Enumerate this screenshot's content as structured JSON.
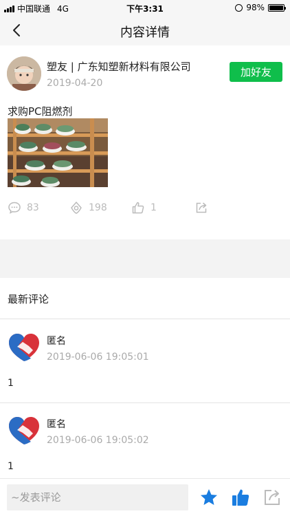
{
  "status_bar": {
    "carrier": "中国联通",
    "network": "4G",
    "time": "下午3:31",
    "battery": "98%",
    "battery_level": 0.98
  },
  "nav": {
    "title": "内容详情",
    "back_icon": "chevron-left-icon"
  },
  "post": {
    "author": "塑友 | 广东知塑新材料有限公司",
    "date": "2019-04-20",
    "add_friend_label": "加好友",
    "text": "求购PC阻燃剂",
    "comments_count": "83",
    "views_count": "198",
    "likes_count": "1",
    "icons": [
      "comment-icon",
      "eye-icon",
      "thumbs-up-icon",
      "share-icon"
    ]
  },
  "comments_section": {
    "title": "最新评论",
    "items": [
      {
        "name": "匿名",
        "date": "2019-06-06 19:05:01",
        "body": "1"
      },
      {
        "name": "匿名",
        "date": "2019-06-06 19:05:02",
        "body": "1"
      }
    ]
  },
  "bottom_bar": {
    "input_placeholder": "~发表评论",
    "icons": [
      "star-icon",
      "thumbs-up-filled-icon",
      "share-icon"
    ]
  },
  "colors": {
    "accent_green": "#0fbe4b",
    "icon_blue": "#1a7de0",
    "muted_gray": "#aaaaaa",
    "background_gray": "#f3f3f3"
  }
}
